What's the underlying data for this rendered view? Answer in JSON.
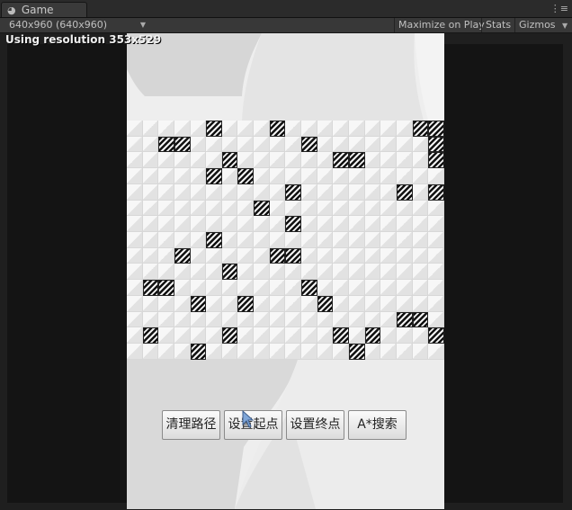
{
  "tab": {
    "title": "Game",
    "icon": "pacman-icon"
  },
  "toolbar": {
    "resolution": "640x960 (640x960)",
    "maximize": "Maximize on Play",
    "stats": "Stats",
    "gizmos": "Gizmos"
  },
  "overlay": {
    "resolution_text": "Using resolution 353x529"
  },
  "grid": {
    "cols": 20,
    "rows": 15,
    "walls": [
      [
        0,
        5
      ],
      [
        0,
        9
      ],
      [
        0,
        18
      ],
      [
        0,
        19
      ],
      [
        1,
        2
      ],
      [
        1,
        3
      ],
      [
        1,
        11
      ],
      [
        1,
        19
      ],
      [
        2,
        6
      ],
      [
        2,
        13
      ],
      [
        2,
        14
      ],
      [
        2,
        19
      ],
      [
        3,
        5
      ],
      [
        3,
        7
      ],
      [
        4,
        10
      ],
      [
        4,
        17
      ],
      [
        4,
        19
      ],
      [
        5,
        8
      ],
      [
        6,
        10
      ],
      [
        7,
        5
      ],
      [
        8,
        3
      ],
      [
        8,
        9
      ],
      [
        8,
        10
      ],
      [
        9,
        6
      ],
      [
        10,
        1
      ],
      [
        10,
        2
      ],
      [
        10,
        11
      ],
      [
        11,
        4
      ],
      [
        11,
        7
      ],
      [
        11,
        12
      ],
      [
        12,
        17
      ],
      [
        12,
        18
      ],
      [
        13,
        1
      ],
      [
        13,
        6
      ],
      [
        13,
        13
      ],
      [
        13,
        15
      ],
      [
        13,
        19
      ],
      [
        14,
        4
      ],
      [
        14,
        14
      ]
    ]
  },
  "buttons": [
    {
      "label": "清理路径"
    },
    {
      "label": "设置起点"
    },
    {
      "label": "设置终点"
    },
    {
      "label": "A*搜索"
    }
  ]
}
